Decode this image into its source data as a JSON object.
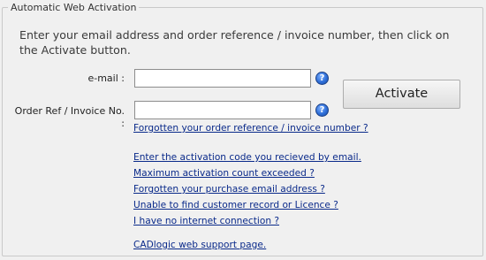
{
  "group_title": "Automatic Web Activation",
  "instructions": "Enter your email address and order reference / invoice number, then click on the Activate button.",
  "email": {
    "label": "e-mail :",
    "value": "",
    "help_glyph": "?"
  },
  "order_ref": {
    "label": "Order Ref / Invoice No. :",
    "value": "",
    "help_glyph": "?"
  },
  "activate_label": "Activate",
  "links": {
    "forgot_order_ref": "Forgotten your order reference / invoice number ?",
    "enter_code": "Enter the activation code you recieved by email.",
    "max_count": "Maximum activation count exceeded ?",
    "forgot_email": "Forgotten your purchase email address ?",
    "no_record": "Unable to find customer record or Licence ?",
    "no_internet": "I have no internet connection ?",
    "support_page": "CADlogic web support page."
  },
  "colors": {
    "link": "#0a2a8a",
    "help_icon": "#2f6fd8",
    "background": "#f0f0f0"
  },
  "icons": {
    "help": "question-mark-help-icon"
  }
}
